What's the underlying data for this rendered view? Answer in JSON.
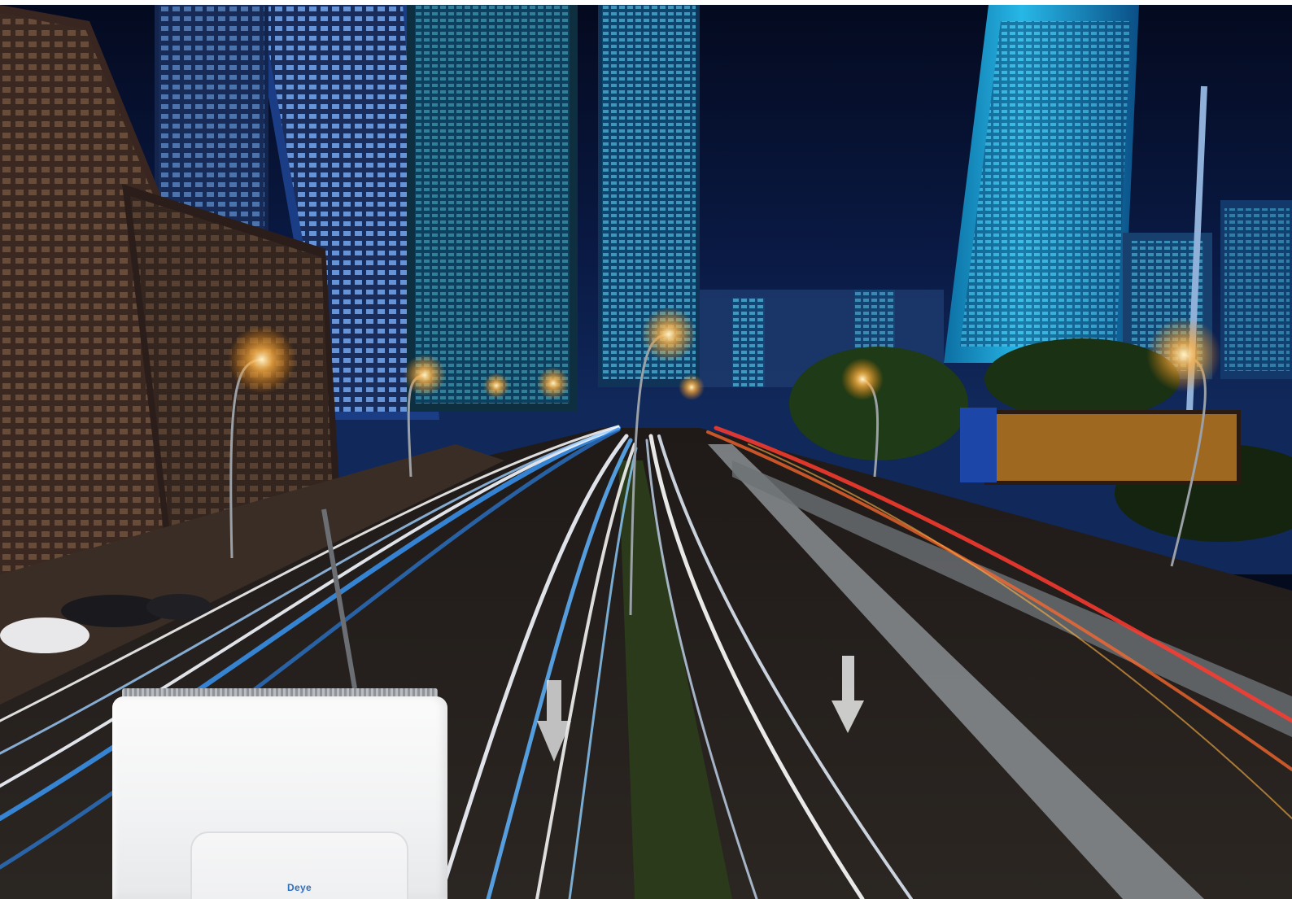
{
  "scene": {
    "subject": "night-city-highway-light-trails",
    "colors": {
      "sky": "#061029",
      "tower_cyan": "#1fa6d6",
      "street_light": "#ffb347",
      "light_trail_white": "#f4f8ff",
      "light_trail_blue": "#3a9cff",
      "tail_light_red": "#ff3b2f"
    }
  },
  "product": {
    "brand_logo": "Deye",
    "color": "#f3f4f5"
  }
}
